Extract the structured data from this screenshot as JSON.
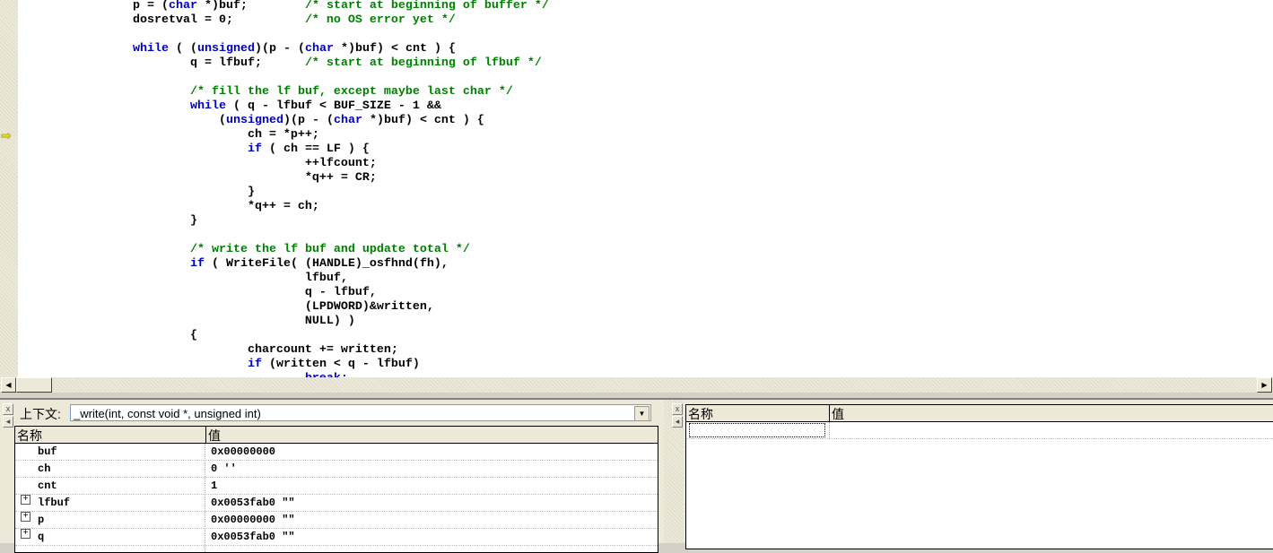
{
  "editor": {
    "current_line_index": 9,
    "colors": {
      "keyword": "#0000c0",
      "comment": "#008000"
    },
    "lines": [
      [
        [
          "                p = (",
          ""
        ],
        [
          "char",
          "kw"
        ],
        [
          " *)buf;        ",
          ""
        ],
        [
          "/* start at beginning of buffer */",
          "cm"
        ]
      ],
      [
        [
          "                dosretval = 0;          ",
          ""
        ],
        [
          "/* no OS error yet */",
          "cm"
        ]
      ],
      [],
      [
        [
          "                ",
          ""
        ],
        [
          "while",
          "kw"
        ],
        [
          " ( (",
          ""
        ],
        [
          "unsigned",
          "kw"
        ],
        [
          ")(p - (",
          ""
        ],
        [
          "char",
          "kw"
        ],
        [
          " *)buf) < cnt ) {",
          ""
        ]
      ],
      [
        [
          "                        q = lfbuf;      ",
          ""
        ],
        [
          "/* start at beginning of lfbuf */",
          "cm"
        ]
      ],
      [],
      [
        [
          "                        ",
          ""
        ],
        [
          "/* fill the lf buf, except maybe last char */",
          "cm"
        ]
      ],
      [
        [
          "                        ",
          ""
        ],
        [
          "while",
          "kw"
        ],
        [
          " ( q - lfbuf < BUF_SIZE - 1 &&",
          ""
        ]
      ],
      [
        [
          "                            (",
          ""
        ],
        [
          "unsigned",
          "kw"
        ],
        [
          ")(p - (",
          ""
        ],
        [
          "char",
          "kw"
        ],
        [
          " *)buf) < cnt ) {",
          ""
        ]
      ],
      [
        [
          "                                ch = *p++;",
          ""
        ]
      ],
      [
        [
          "                                ",
          ""
        ],
        [
          "if",
          "kw"
        ],
        [
          " ( ch == LF ) {",
          ""
        ]
      ],
      [
        [
          "                                        ++lfcount;",
          ""
        ]
      ],
      [
        [
          "                                        *q++ = CR;",
          ""
        ]
      ],
      [
        [
          "                                }",
          ""
        ]
      ],
      [
        [
          "                                *q++ = ch;",
          ""
        ]
      ],
      [
        [
          "                        }",
          ""
        ]
      ],
      [],
      [
        [
          "                        ",
          ""
        ],
        [
          "/* write the lf buf and update total */",
          "cm"
        ]
      ],
      [
        [
          "                        ",
          ""
        ],
        [
          "if",
          "kw"
        ],
        [
          " ( WriteFile( (HANDLE)_osfhnd(fh),",
          ""
        ]
      ],
      [
        [
          "                                        lfbuf,",
          ""
        ]
      ],
      [
        [
          "                                        q - lfbuf,",
          ""
        ]
      ],
      [
        [
          "                                        (LPDWORD)&written,",
          ""
        ]
      ],
      [
        [
          "                                        NULL) )",
          ""
        ]
      ],
      [
        [
          "                        {",
          ""
        ]
      ],
      [
        [
          "                                charcount += written;",
          ""
        ]
      ],
      [
        [
          "                                ",
          ""
        ],
        [
          "if",
          "kw"
        ],
        [
          " (written < q - lfbuf)",
          ""
        ]
      ],
      [
        [
          "                                        ",
          ""
        ],
        [
          "break;",
          "kw"
        ]
      ]
    ]
  },
  "variables": {
    "context_label": "上下文:",
    "context_value": "_write(int, const void *, unsigned int)",
    "col_name": "名称",
    "col_value": "值",
    "rows": [
      {
        "name": "buf",
        "value": "0x00000000",
        "expandable": false
      },
      {
        "name": "ch",
        "value": "0 ''",
        "expandable": false
      },
      {
        "name": "cnt",
        "value": "1",
        "expandable": false
      },
      {
        "name": "lfbuf",
        "value": "0x0053fab0 \"\"",
        "expandable": true
      },
      {
        "name": "p",
        "value": "0x00000000 \"\"",
        "expandable": true
      },
      {
        "name": "q",
        "value": "0x0053fab0 \"\"",
        "expandable": true
      }
    ]
  },
  "watch": {
    "col_name": "名称",
    "col_value": "值"
  }
}
